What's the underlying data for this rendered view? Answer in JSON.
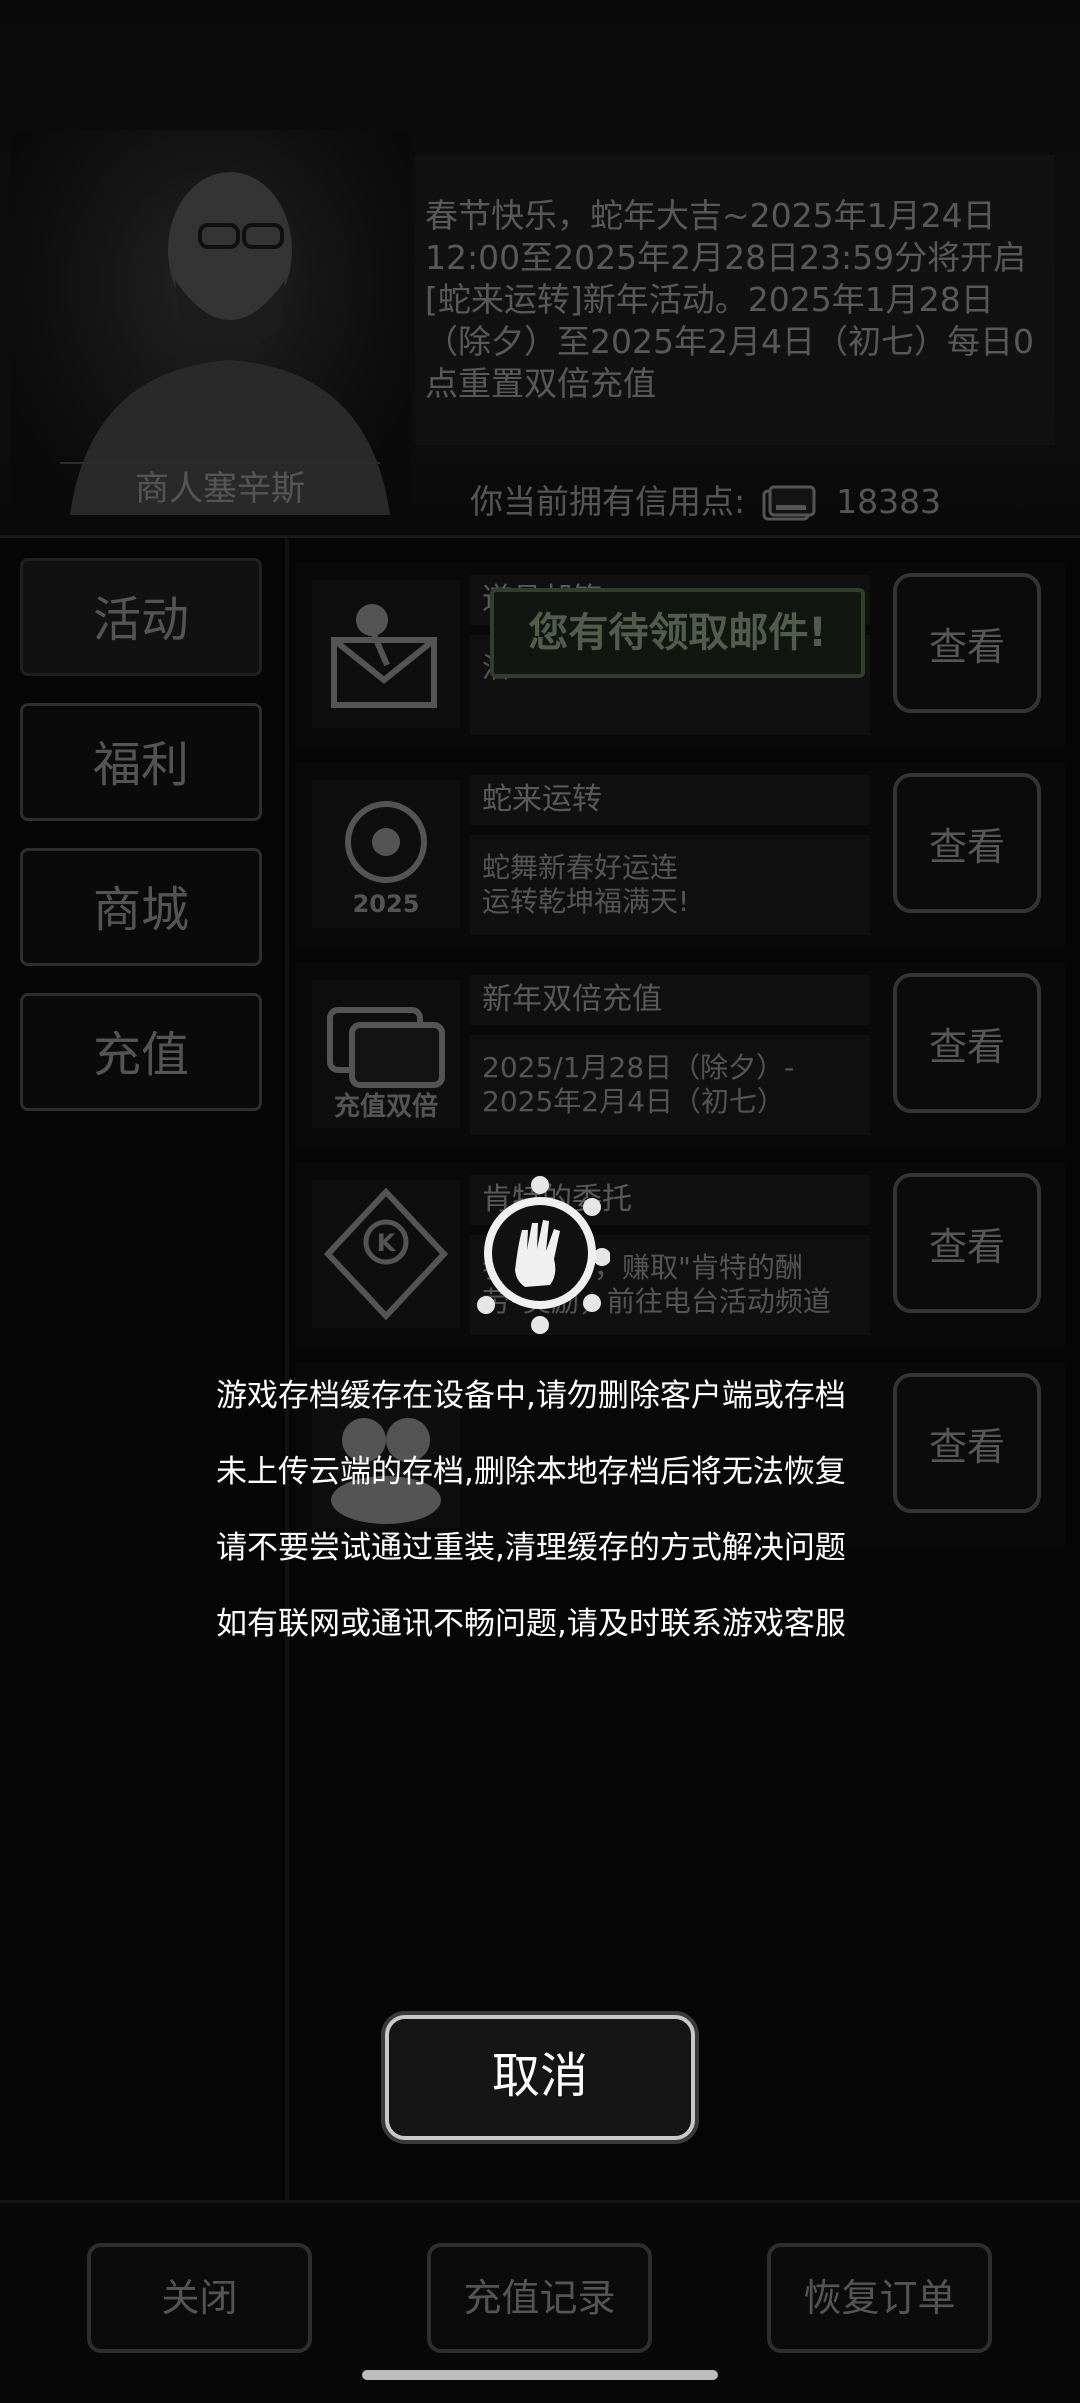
{
  "merchant": {
    "name": "商人塞辛斯"
  },
  "announcement": "春节快乐，蛇年大吉~2025年1月24日12:00至2025年2月28日23:59分将开启[蛇来运转]新年活动。2025年1月28日（除夕）至2025年2月4日（初七）每日0点重置双倍充值",
  "credit": {
    "label": "你当前拥有信用点:",
    "value": "18383",
    "icon": "credit-card-icon"
  },
  "tabs": [
    {
      "label": "活动",
      "active": true
    },
    {
      "label": "福利",
      "active": false
    },
    {
      "label": "商城",
      "active": false
    },
    {
      "label": "充值",
      "active": false
    }
  ],
  "activities": [
    {
      "title": "道具邮箱",
      "desc": "活",
      "tip": "您有待领取邮件!",
      "button": "查看",
      "icon": "mail-pin-icon"
    },
    {
      "title": "蛇来运转",
      "desc": "蛇舞新春好运连\n运转乾坤福满天!",
      "button": "查看",
      "icon": "snake-2025-icon",
      "icon_text": "2025"
    },
    {
      "title": "新年双倍充值",
      "desc": "2025/1月28日（除夕）- 2025年2月4日（初七）",
      "button": "查看",
      "icon": "card-double-icon",
      "icon_text": "充值双倍"
    },
    {
      "title": "肯特的委托",
      "desc": "参与活动，赚取\"肯特的酬劳\"奖励，前往电台活动频道",
      "button": "查看",
      "icon": "emblem-k-icon"
    },
    {
      "title": "",
      "desc": "",
      "button": "查看",
      "icon": "group-icon"
    }
  ],
  "overlay": {
    "lines": [
      "游戏存档缓存在设备中,请勿删除客户端或存档",
      "未上传云端的存档,删除本地存档后将无法恢复",
      "请不要尝试通过重装,清理缓存的方式解决问题",
      "如有联网或通讯不畅问题,请及时联系游戏客服"
    ],
    "cancel": "取消"
  },
  "footer": {
    "close": "关闭",
    "records": "充值记录",
    "restore": "恢复订单"
  }
}
